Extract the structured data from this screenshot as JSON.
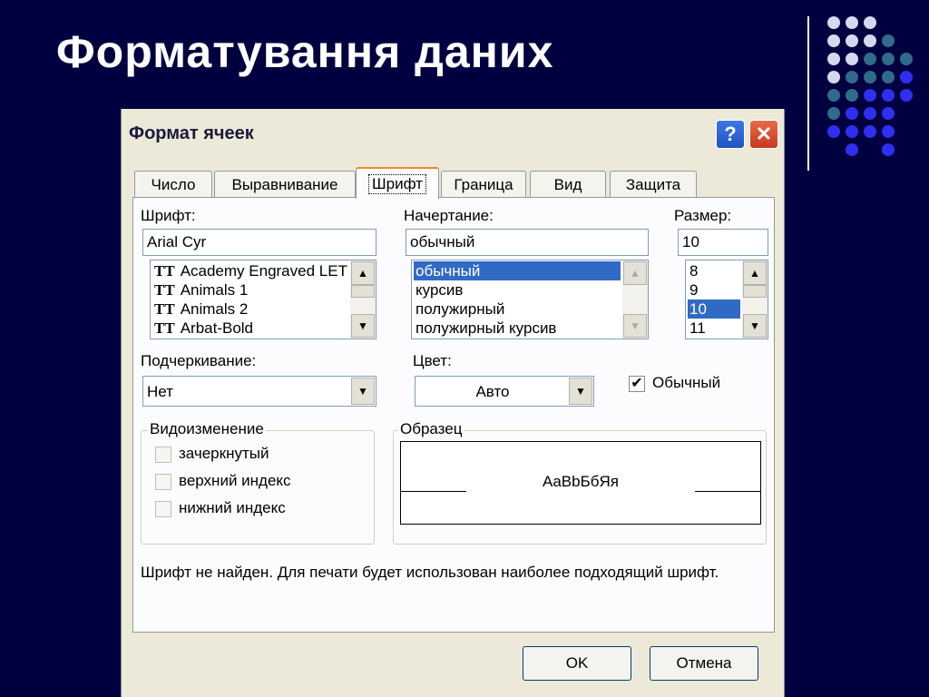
{
  "slide": {
    "title": "Форматування даних"
  },
  "dialog": {
    "title": "Формат ячеек",
    "help_label": "?",
    "close_label": "✕",
    "tabs": [
      {
        "label": "Число"
      },
      {
        "label": "Выравнивание"
      },
      {
        "label": "Шрифт",
        "active": true
      },
      {
        "label": "Граница"
      },
      {
        "label": "Вид"
      },
      {
        "label": "Защита"
      }
    ],
    "font": {
      "label": "Шрифт:",
      "value": "Arial Cyr",
      "items": [
        "Academy Engraved LET",
        "Animals 1",
        "Animals 2",
        "Arbat-Bold"
      ]
    },
    "style": {
      "label": "Начертание:",
      "value": "обычный",
      "items": [
        "обычный",
        "курсив",
        "полужирный",
        "полужирный курсив"
      ],
      "selected": "обычный"
    },
    "size": {
      "label": "Размер:",
      "value": "10",
      "items": [
        "8",
        "9",
        "10",
        "11"
      ],
      "selected": "10"
    },
    "underline": {
      "label": "Подчеркивание:",
      "value": "Нет"
    },
    "color": {
      "label": "Цвет:",
      "value": "Авто"
    },
    "normal": {
      "label": "Обычный",
      "checked": true
    },
    "effects": {
      "title": "Видоизменение",
      "items": [
        "зачеркнутый",
        "верхний индекс",
        "нижний индекс"
      ]
    },
    "sample": {
      "title": "Образец",
      "text": "AaBbБбЯя"
    },
    "message": "Шрифт не найден. Для печати будет использован наиболее подходящий шрифт.",
    "ok_label": "OK",
    "cancel_label": "Отмена"
  },
  "icons": {
    "truetype": "TT",
    "scroll_up": "▲",
    "scroll_down": "▼",
    "check": "✔"
  },
  "colors": {
    "slide_bg": "#000040",
    "dots_light": "#c9c9e6",
    "dots_teal": "#2f6b8a",
    "dots_blue": "#2f2ff0",
    "selection": "#316ac5"
  }
}
